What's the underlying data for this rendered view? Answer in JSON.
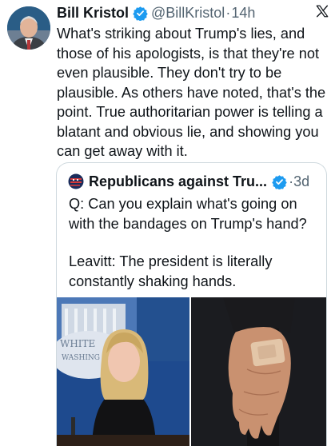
{
  "tweet": {
    "author_name": "Bill Kristol",
    "handle": "@BillKristol",
    "separator": "·",
    "time": "14h",
    "text": "What's striking about Trump's lies, and those of his apologists, is that they're not even plausible. They don't try to be plausible. As others have noted, that's the point. True authoritarian power is telling a blatant and obvious lie, and showing you can get away with it.",
    "icons": {
      "avatar": "avatar-photo",
      "verified": "verified-badge-icon",
      "brand": "x-logo-icon"
    }
  },
  "quoted": {
    "author_name": "Republicans against Tru...",
    "separator": "·",
    "time": "3d",
    "question": "Q: Can you explain what's going on with the bandages on Trump's hand?",
    "answer": "Leavitt: The president is literally constantly shaking hands.",
    "photo_sign_line1": "WHITE",
    "photo_sign_line2": "WASHING",
    "icons": {
      "avatar": "flag-logo-icon",
      "verified": "verified-badge-icon"
    }
  },
  "colors": {
    "text": "#0f1419",
    "secondary": "#536471",
    "verified": "#1d9bf0",
    "border": "#cfd9de"
  }
}
